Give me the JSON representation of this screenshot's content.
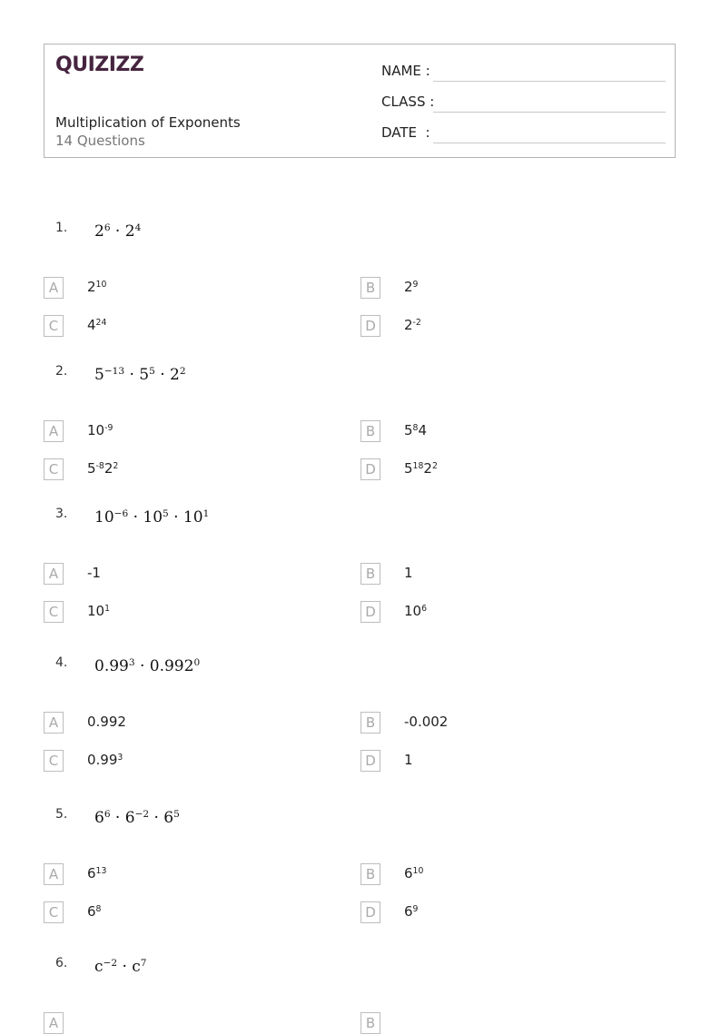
{
  "header": {
    "logo": "QUIZIZZ",
    "title": "Multiplication of Exponents",
    "question_count": "14 Questions",
    "fields": [
      {
        "label": "NAME :"
      },
      {
        "label": "CLASS :"
      },
      {
        "label": "DATE  :"
      }
    ]
  },
  "questions": [
    {
      "number": "1.",
      "expression": [
        [
          "2",
          "6"
        ],
        [
          " · 2",
          "4"
        ]
      ],
      "options": [
        {
          "letter": "A",
          "parts": [
            [
              "2",
              "10"
            ]
          ]
        },
        {
          "letter": "B",
          "parts": [
            [
              "2",
              "9"
            ]
          ]
        },
        {
          "letter": "C",
          "parts": [
            [
              "4",
              "24"
            ]
          ]
        },
        {
          "letter": "D",
          "parts": [
            [
              "2",
              "-2"
            ]
          ]
        }
      ]
    },
    {
      "number": "2.",
      "expression": [
        [
          "5",
          "−13"
        ],
        [
          " · 5",
          "5"
        ],
        [
          " · 2",
          "2"
        ]
      ],
      "options": [
        {
          "letter": "A",
          "parts": [
            [
              "10",
              "-9"
            ]
          ]
        },
        {
          "letter": "B",
          "parts": [
            [
              "5",
              "8"
            ],
            [
              "4",
              ""
            ]
          ]
        },
        {
          "letter": "C",
          "parts": [
            [
              "5",
              "-8"
            ],
            [
              "2",
              "2"
            ]
          ]
        },
        {
          "letter": "D",
          "parts": [
            [
              "5",
              "18"
            ],
            [
              "2",
              "2"
            ]
          ]
        }
      ]
    },
    {
      "number": "3.",
      "expression": [
        [
          "10",
          "−6"
        ],
        [
          " · 10",
          "5"
        ],
        [
          " · 10",
          "1"
        ]
      ],
      "options": [
        {
          "letter": "A",
          "parts": [
            [
              "-1",
              ""
            ]
          ]
        },
        {
          "letter": "B",
          "parts": [
            [
              "1",
              ""
            ]
          ]
        },
        {
          "letter": "C",
          "parts": [
            [
              "10",
              "1"
            ]
          ]
        },
        {
          "letter": "D",
          "parts": [
            [
              "10",
              "6"
            ]
          ]
        }
      ]
    },
    {
      "number": "4.",
      "expression": [
        [
          "0.99",
          "3"
        ],
        [
          " · 0.992",
          "0"
        ]
      ],
      "options": [
        {
          "letter": "A",
          "parts": [
            [
              "0.992",
              ""
            ]
          ]
        },
        {
          "letter": "B",
          "parts": [
            [
              "-0.002",
              ""
            ]
          ]
        },
        {
          "letter": "C",
          "parts": [
            [
              "0.99",
              "3"
            ]
          ]
        },
        {
          "letter": "D",
          "parts": [
            [
              "1",
              ""
            ]
          ]
        }
      ]
    },
    {
      "number": "5.",
      "expression": [
        [
          "6",
          "6"
        ],
        [
          " · 6",
          "−2"
        ],
        [
          " · 6",
          "5"
        ]
      ],
      "options": [
        {
          "letter": "A",
          "parts": [
            [
              "6",
              "13"
            ]
          ]
        },
        {
          "letter": "B",
          "parts": [
            [
              "6",
              "10"
            ]
          ]
        },
        {
          "letter": "C",
          "parts": [
            [
              "6",
              "8"
            ]
          ]
        },
        {
          "letter": "D",
          "parts": [
            [
              "6",
              "9"
            ]
          ]
        }
      ]
    },
    {
      "number": "6.",
      "expression": [
        [
          "c",
          "−2"
        ],
        [
          " · c",
          "7"
        ]
      ],
      "options": [
        {
          "letter": "A",
          "parts": [
            [
              "",
              ""
            ]
          ]
        },
        {
          "letter": "B",
          "parts": [
            [
              "",
              ""
            ]
          ]
        }
      ]
    }
  ]
}
